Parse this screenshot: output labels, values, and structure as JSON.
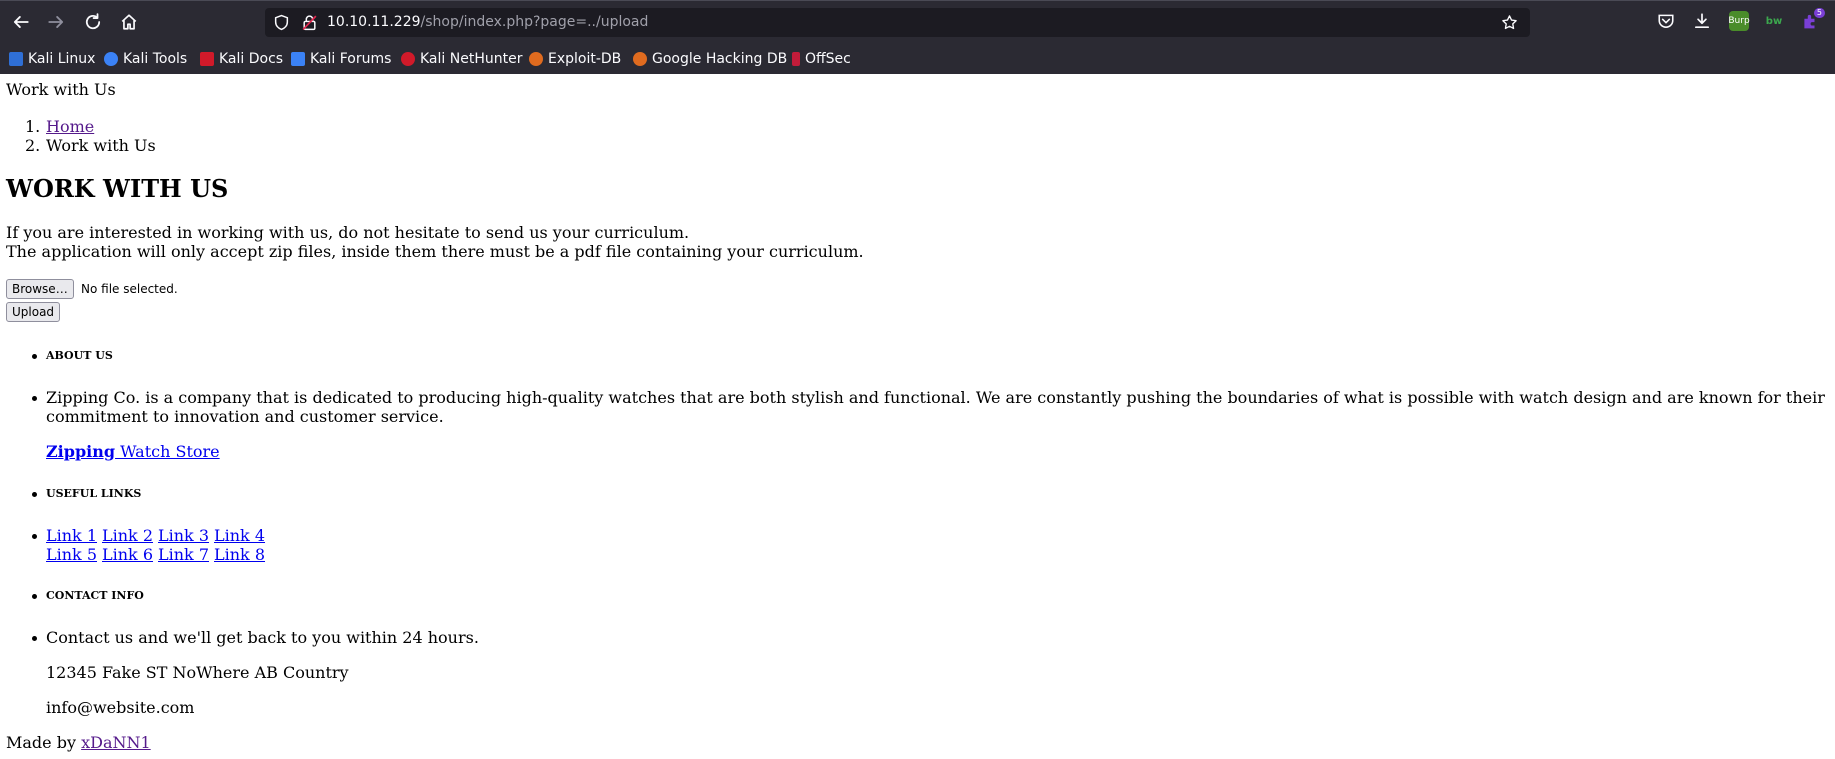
{
  "browser": {
    "url_host": "10.10.11.229",
    "url_path": "/shop/index.php?page=../upload",
    "extensions": {
      "burp_label": "Burp",
      "bitwarden_label": "bw",
      "badge_count": "5"
    },
    "bookmarks": [
      {
        "label": "Kali Linux",
        "color": "#2f6fd6"
      },
      {
        "label": "Kali Tools",
        "color": "#3b82f6"
      },
      {
        "label": "Kali Docs",
        "color": "#d11a2a"
      },
      {
        "label": "Kali Forums",
        "color": "#3b82f6"
      },
      {
        "label": "Kali NetHunter",
        "color": "#d11a2a"
      },
      {
        "label": "Exploit-DB",
        "color": "#e06b1f"
      },
      {
        "label": "Google Hacking DB",
        "color": "#e06b1f"
      },
      {
        "label": "OffSec",
        "color": "#c21c3a"
      }
    ]
  },
  "page": {
    "top_title": "Work with Us",
    "breadcrumb": {
      "n1": "1.",
      "home": "Home",
      "n2": "2.",
      "current": "Work with Us"
    },
    "heading": "WORK WITH US",
    "intro_line1": "If you are interested in working with us, do not hesitate to send us your curriculum.",
    "intro_line2": "The application will only accept zip files, inside them there must be a pdf file containing your curriculum.",
    "upload": {
      "browse_label": "Browse…",
      "no_file_text": "No file selected.",
      "upload_label": "Upload"
    },
    "footer": {
      "about_heading": "ABOUT US",
      "about_text_line1": "Zipping Co. is a company that is dedicated to producing high-quality watches that are both stylish and functional. We are constantly pushing the boundaries of what is possible with watch design and are known for their",
      "about_text_line2": "commitment to innovation and customer service.",
      "brand_bold": "Zipping",
      "brand_rest": " Watch Store",
      "useful_heading": "USEFUL LINKS",
      "links": [
        "Link 1",
        "Link 2",
        "Link 3",
        "Link 4",
        "Link 5",
        "Link 6",
        "Link 7",
        "Link 8"
      ],
      "contact_heading": "CONTACT INFO",
      "contact_text": "Contact us and we'll get back to you within 24 hours.",
      "address": "12345 Fake ST NoWhere AB Country",
      "email": "info@website.com",
      "made_by_prefix": "Made by ",
      "made_by_author": "xDaNN1"
    }
  }
}
